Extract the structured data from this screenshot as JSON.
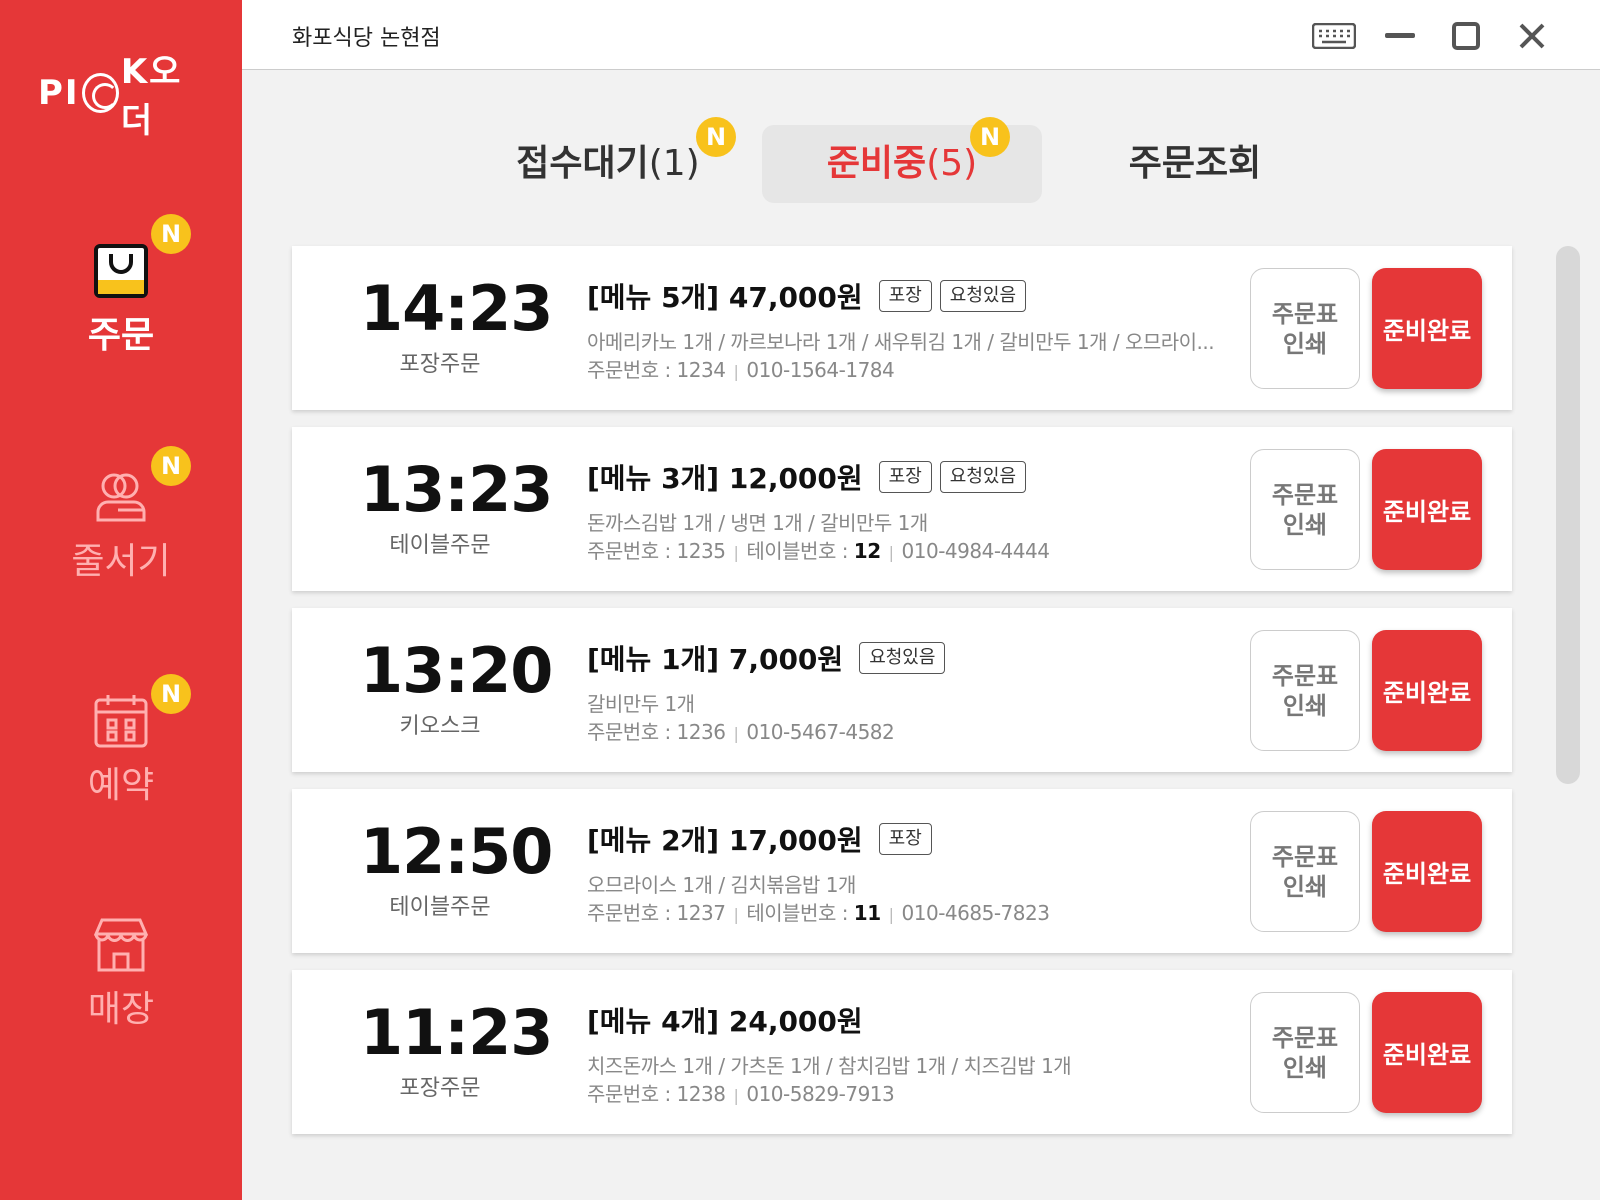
{
  "app": {
    "logo_text_left": "PI",
    "logo_text_right": "K오더",
    "store_name": "화포식당 논현점",
    "accent_color": "#e53738",
    "badge_color": "#f8c21c"
  },
  "window_controls": [
    {
      "name": "keyboard-icon"
    },
    {
      "name": "minimize-icon"
    },
    {
      "name": "maximize-icon"
    },
    {
      "name": "close-icon"
    }
  ],
  "sidebar": {
    "items": [
      {
        "label": "주문",
        "icon": "shopping-bag-icon",
        "badge": "N",
        "active": true
      },
      {
        "label": "줄서기",
        "icon": "queue-people-icon",
        "badge": "N",
        "active": false
      },
      {
        "label": "예약",
        "icon": "calendar-icon",
        "badge": "N",
        "active": false
      },
      {
        "label": "매장",
        "icon": "store-icon",
        "badge": "",
        "active": false
      }
    ]
  },
  "tabs": [
    {
      "label": "접수대기",
      "count": "(1)",
      "badge": "N",
      "active": false
    },
    {
      "label": "준비중",
      "count": "(5)",
      "badge": "N",
      "active": true
    },
    {
      "label": "주문조회",
      "count": "",
      "badge": "",
      "active": false
    }
  ],
  "orders": [
    {
      "time": "14:23",
      "type": "포장주문",
      "summary": "[메뉴 5개] 47,000원",
      "tags": [
        "포장",
        "요청있음"
      ],
      "items": "아메리카노 1개 / 까르보나라 1개 / 새우튀김 1개 / 갈비만두 1개 / 오므라이...",
      "order_no": "주문번호 : 1234",
      "table_label": "",
      "table_no": "",
      "phone": "010-1564-1784",
      "print_label_1": "주문표",
      "print_label_2": "인쇄",
      "done_label": "준비완료"
    },
    {
      "time": "13:23",
      "type": "테이블주문",
      "summary": "[메뉴 3개] 12,000원",
      "tags": [
        "포장",
        "요청있음"
      ],
      "items": "돈까스김밥 1개 / 냉면 1개 / 갈비만두 1개",
      "order_no": "주문번호 : 1235",
      "table_label": "테이블번호 : ",
      "table_no": "12",
      "phone": "010-4984-4444",
      "print_label_1": "주문표",
      "print_label_2": "인쇄",
      "done_label": "준비완료"
    },
    {
      "time": "13:20",
      "type": "키오스크",
      "summary": "[메뉴 1개] 7,000원",
      "tags": [
        "요청있음"
      ],
      "items": "갈비만두 1개",
      "order_no": "주문번호 : 1236",
      "table_label": "",
      "table_no": "",
      "phone": "010-5467-4582",
      "print_label_1": "주문표",
      "print_label_2": "인쇄",
      "done_label": "준비완료"
    },
    {
      "time": "12:50",
      "type": "테이블주문",
      "summary": "[메뉴 2개] 17,000원",
      "tags": [
        "포장"
      ],
      "items": "오므라이스 1개 / 김치볶음밥 1개",
      "order_no": "주문번호 : 1237",
      "table_label": "테이블번호 : ",
      "table_no": "11",
      "phone": "010-4685-7823",
      "print_label_1": "주문표",
      "print_label_2": "인쇄",
      "done_label": "준비완료"
    },
    {
      "time": "11:23",
      "type": "포장주문",
      "summary": "[메뉴 4개] 24,000원",
      "tags": [],
      "items": "치즈돈까스 1개 / 가츠돈 1개 / 참치김밥 1개 / 치즈김밥 1개",
      "order_no": "주문번호 : 1238",
      "table_label": "",
      "table_no": "",
      "phone": "010-5829-7913",
      "print_label_1": "주문표",
      "print_label_2": "인쇄",
      "done_label": "준비완료"
    }
  ]
}
